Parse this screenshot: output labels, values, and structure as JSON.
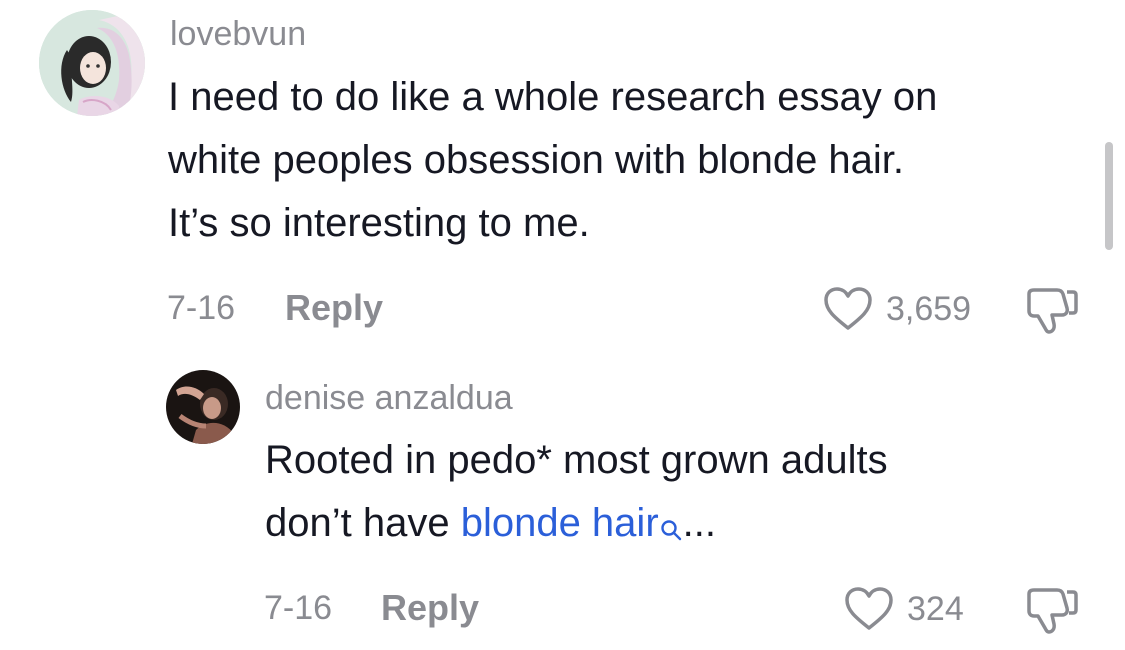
{
  "comments": [
    {
      "username": "lovebvun",
      "text_lines": [
        "I need to do like a whole research essay on",
        "white peoples obsession with blonde hair.",
        "It’s so interesting to me."
      ],
      "date": "7-16",
      "reply_label": "Reply",
      "likes": "3,659"
    }
  ],
  "replies": [
    {
      "username": "denise anzaldua",
      "text_line1": "Rooted in pedo* most grown adults",
      "text_line2_prefix": "don’t have ",
      "link_text": "blonde hair",
      "text_line2_suffix": "...",
      "date": "7-16",
      "reply_label": "Reply",
      "likes": "324"
    }
  ],
  "icons": {
    "like": "heart-outline-icon",
    "dislike": "thumbs-down-icon",
    "search": "search-icon"
  },
  "colors": {
    "text": "#161823",
    "muted": "#8a8b91",
    "link": "#2b5fd9"
  }
}
